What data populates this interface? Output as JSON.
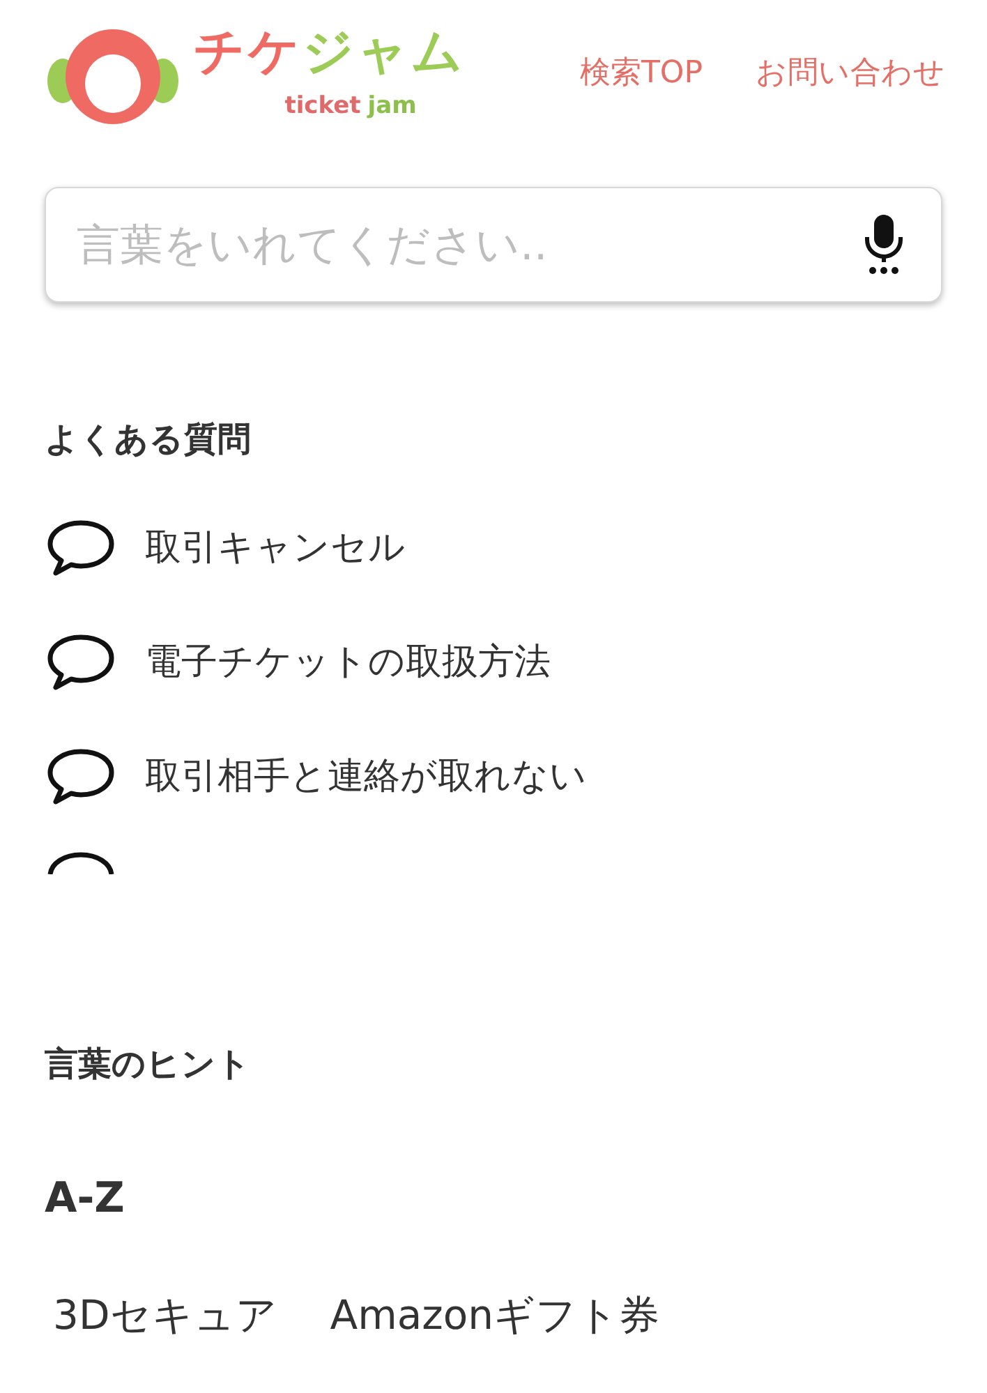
{
  "header": {
    "logo": {
      "name_parts": [
        {
          "text": "チケ",
          "color": "#ef6a62"
        },
        {
          "text": "ジャム",
          "color": "#9ccc55"
        }
      ],
      "sub_parts": [
        {
          "text": "ticket",
          "color": "#e06a6a"
        },
        {
          "text": "jam",
          "color": "#8cc04a"
        }
      ]
    },
    "links": [
      "検索TOP",
      "お問い合わせ"
    ]
  },
  "search": {
    "placeholder": "言葉をいれてください.."
  },
  "faq": {
    "title": "よくある質問",
    "items": [
      "取引キャンセル",
      "電子チケットの取扱方法",
      "取引相手と連絡が取れない"
    ]
  },
  "hints": {
    "title": "言葉のヒント",
    "section": "A-Z",
    "words": [
      "3Dセキュア",
      "Amazonギフト券"
    ]
  }
}
